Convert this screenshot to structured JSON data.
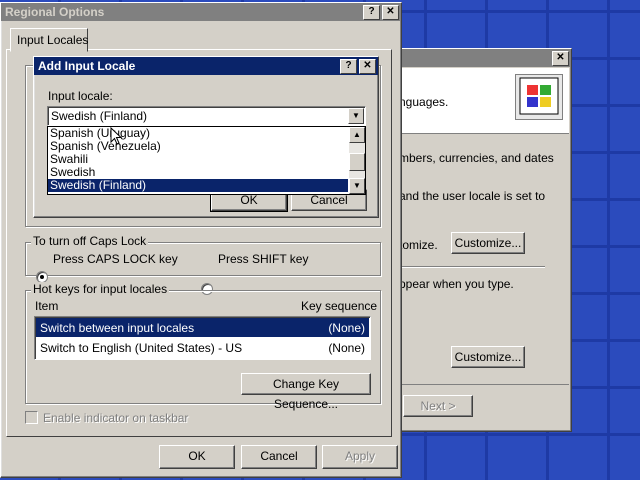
{
  "regional": {
    "title": "Regional Options",
    "help": "?",
    "close": "✕",
    "tab": "Input Locales",
    "caps_group": "To turn off Caps Lock",
    "radio_caps": "Press CAPS LOCK key",
    "radio_shift": "Press SHIFT key",
    "hotkeys_group": "Hot keys for input locales",
    "col_item": "Item",
    "col_key": "Key sequence",
    "rows": [
      {
        "item": "Switch between input locales",
        "key": "(None)"
      },
      {
        "item": "Switch to English (United States) - US",
        "key": "(None)"
      }
    ],
    "change_key": "Change Key Sequence...",
    "indicator": "Enable indicator on taskbar",
    "ok": "OK",
    "cancel": "Cancel",
    "apply": "Apply"
  },
  "background_win": {
    "close": "✕",
    "text1": "nguages.",
    "text2": "mbers, currencies, and dates",
    "text3": "and the user locale is set to",
    "text3b": ".",
    "text4": "tomize.",
    "customize1": "Customize...",
    "text5": "ppear when you type.",
    "customize2": "Customize...",
    "next": "Next >"
  },
  "add_locale": {
    "title": "Add Input Locale",
    "help": "?",
    "close": "✕",
    "label": "Input locale:",
    "selected": "Swedish (Finland)",
    "options": [
      "Spanish (Uruguay)",
      "Spanish (Venezuela)",
      "Swahili",
      "Swedish",
      "Swedish (Finland)"
    ],
    "ok": "OK",
    "cancel": "Cancel"
  }
}
